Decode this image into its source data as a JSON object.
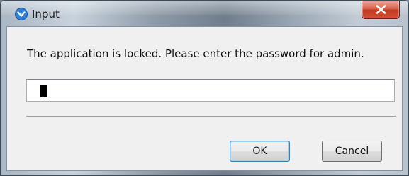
{
  "window": {
    "title": "Input",
    "icon": "app-chevron-icon",
    "close_icon": "close-icon"
  },
  "dialog": {
    "prompt": "The application is locked. Please enter the password for admin.",
    "password_value": ""
  },
  "buttons": {
    "ok_label": "OK",
    "cancel_label": "Cancel"
  },
  "colors": {
    "close_button": "#c2381f",
    "app_icon": "#2f7fd6",
    "client_background": "#f0f0f0"
  }
}
